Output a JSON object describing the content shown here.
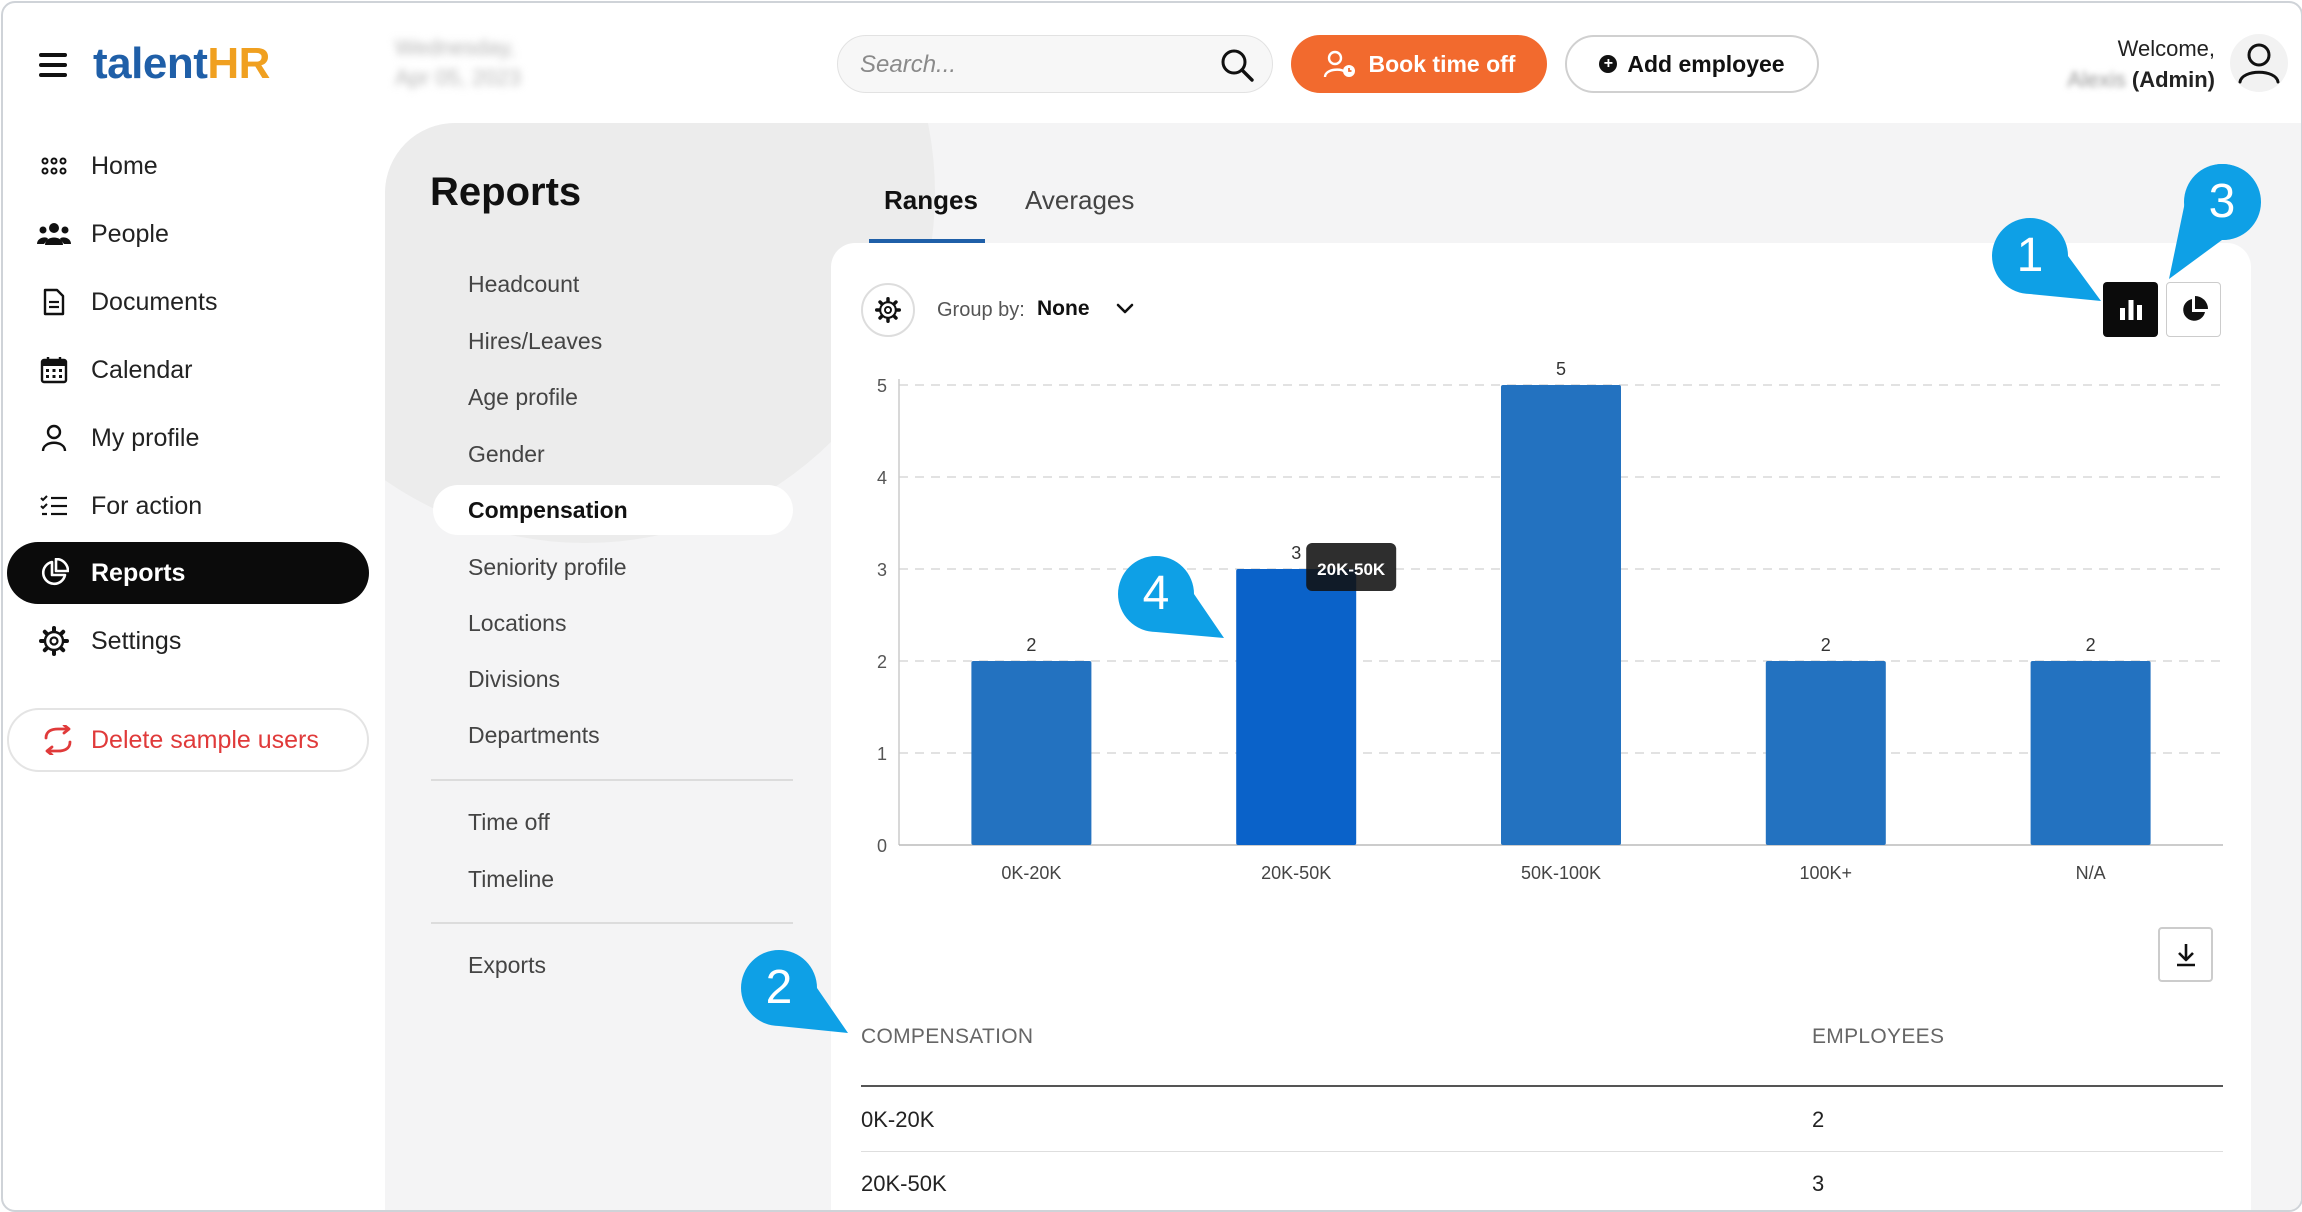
{
  "header": {
    "logo_primary": "talent",
    "logo_accent": "HR",
    "date_line1": "Wednesday,",
    "date_line2": "Apr 05, 2023",
    "search_placeholder": "Search...",
    "book_time_off": "Book time off",
    "add_employee": "Add employee",
    "welcome": "Welcome,",
    "user_name": "Alexis",
    "user_role": "(Admin)",
    "brand_color": "#1f5fa8",
    "accent_color": "#f26a2e"
  },
  "sidebar": {
    "items": [
      {
        "label": "Home",
        "icon": "grid-icon"
      },
      {
        "label": "People",
        "icon": "people-icon"
      },
      {
        "label": "Documents",
        "icon": "document-icon"
      },
      {
        "label": "Calendar",
        "icon": "calendar-icon"
      },
      {
        "label": "My profile",
        "icon": "user-icon"
      },
      {
        "label": "For action",
        "icon": "checklist-icon"
      },
      {
        "label": "Reports",
        "icon": "pie-chart-icon",
        "active": true
      },
      {
        "label": "Settings",
        "icon": "gear-icon"
      }
    ],
    "delete_sample_users": "Delete sample users"
  },
  "reports": {
    "title": "Reports",
    "menu": [
      "Headcount",
      "Hires/Leaves",
      "Age profile",
      "Gender",
      "Compensation",
      "Seniority profile",
      "Locations",
      "Divisions",
      "Departments"
    ],
    "menu_active": "Compensation",
    "menu2": [
      "Time off",
      "Timeline"
    ],
    "menu3": [
      "Exports"
    ]
  },
  "tabs": [
    {
      "label": "Ranges",
      "active": true
    },
    {
      "label": "Averages",
      "active": false
    }
  ],
  "controls": {
    "group_by_label": "Group by:",
    "group_by_value": "None"
  },
  "chart_data": {
    "type": "bar",
    "categories": [
      "0K-20K",
      "20K-50K",
      "50K-100K",
      "100K+",
      "N/A"
    ],
    "values": [
      2,
      3,
      5,
      2,
      2
    ],
    "data_labels": [
      "2",
      "3",
      "5",
      "2",
      "2"
    ],
    "yticks": [
      "0",
      "1",
      "2",
      "3",
      "4",
      "5"
    ],
    "ylim": [
      0,
      5
    ],
    "grid": true,
    "highlighted_category": "20K-50K",
    "tooltip": "20K-50K",
    "bar_color": "#2372c0",
    "highlight_color": "#0a62c9"
  },
  "table": {
    "headers": [
      "COMPENSATION",
      "EMPLOYEES"
    ],
    "rows": [
      [
        "0K-20K",
        "2"
      ],
      [
        "20K-50K",
        "3"
      ]
    ]
  },
  "callouts": [
    "1",
    "2",
    "3",
    "4"
  ],
  "callout_color": "#0ea0e6"
}
